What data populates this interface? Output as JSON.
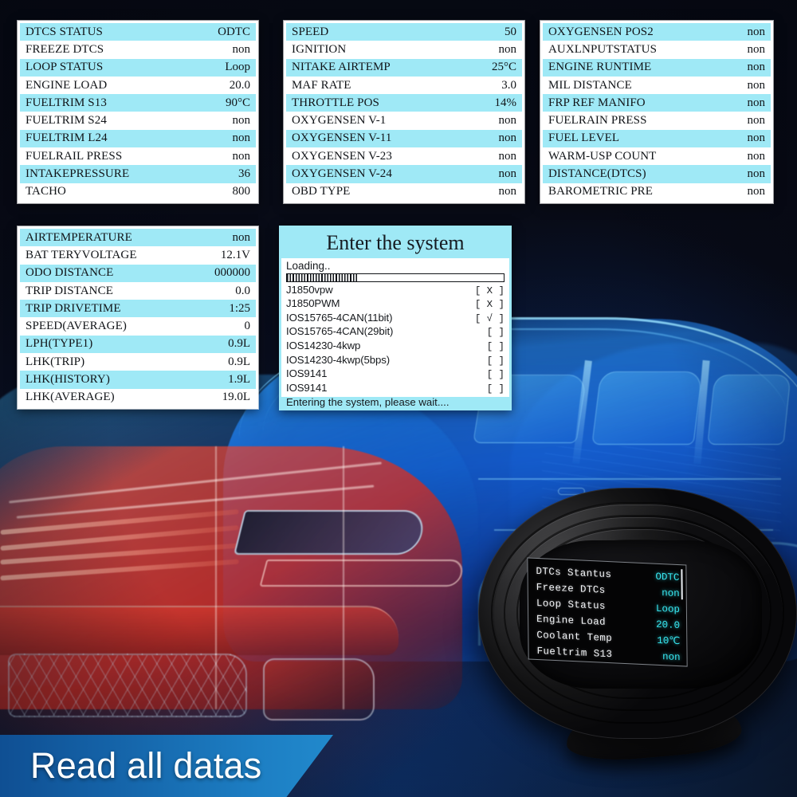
{
  "background": {
    "scene_description": "x-ray style car render",
    "colors": {
      "page_bg": "#080b16",
      "car_blue": "#1a7ae8",
      "car_red": "#cd2d24",
      "accent_cyan": "#9fe9f6"
    }
  },
  "panels": {
    "dtcs": {
      "name": "DTCS STATUS panel",
      "rows": [
        {
          "key": "DTCS STATUS",
          "value": "ODTC"
        },
        {
          "key": "FREEZE DTCS",
          "value": "non"
        },
        {
          "key": "LOOP STATUS",
          "value": "Loop"
        },
        {
          "key": "ENGINE LOAD",
          "value": "20.0"
        },
        {
          "key": "FUELTRIM S13",
          "value": "90°C"
        },
        {
          "key": "FUELTRIM S24",
          "value": "non"
        },
        {
          "key": "FUELTRIM L24",
          "value": "non"
        },
        {
          "key": "FUELRAIL PRESS",
          "value": "non"
        },
        {
          "key": "INTAKEPRESSURE",
          "value": "36"
        },
        {
          "key": "TACHO",
          "value": "800"
        }
      ]
    },
    "engine": {
      "name": "Engine data panel",
      "rows": [
        {
          "key": "SPEED",
          "value": "50"
        },
        {
          "key": "IGNITION",
          "value": "non"
        },
        {
          "key": "NITAKE AIRTEMP",
          "value": "25°C"
        },
        {
          "key": "MAF RATE",
          "value": "3.0"
        },
        {
          "key": "THROTTLE POS",
          "value": "14%"
        },
        {
          "key": "OXYGENSEN V-1",
          "value": "non"
        },
        {
          "key": "OXYGENSEN V-11",
          "value": "non"
        },
        {
          "key": "OXYGENSEN V-23",
          "value": "non"
        },
        {
          "key": "OXYGENSEN V-24",
          "value": "non"
        },
        {
          "key": "OBD TYPE",
          "value": "non"
        }
      ]
    },
    "sensors": {
      "name": "Sensor data panel",
      "rows": [
        {
          "key": "OXYGENSEN POS2",
          "value": "non"
        },
        {
          "key": "AUXLNPUTSTATUS",
          "value": "non"
        },
        {
          "key": "ENGINE RUNTIME",
          "value": "non"
        },
        {
          "key": "MIL DISTANCE",
          "value": "non"
        },
        {
          "key": "FRP REF MANIFO",
          "value": "non"
        },
        {
          "key": "FUELRAIN PRESS",
          "value": "non"
        },
        {
          "key": "FUEL LEVEL",
          "value": "non"
        },
        {
          "key": "WARM-USP COUNT",
          "value": "non"
        },
        {
          "key": "DISTANCE(DTCS)",
          "value": "non"
        },
        {
          "key": "BAROMETRIC PRE",
          "value": "non"
        }
      ]
    },
    "trip": {
      "name": "Trip data panel",
      "rows": [
        {
          "key": "AIRTEMPERATURE",
          "value": "non"
        },
        {
          "key": "BAT TERYVOLTAGE",
          "value": "12.1V"
        },
        {
          "key": "ODO DISTANCE",
          "value": "000000"
        },
        {
          "key": "TRIP DISTANCE",
          "value": "0.0"
        },
        {
          "key": "TRIP DRIVETIME",
          "value": "1:25"
        },
        {
          "key": "SPEED(AVERAGE)",
          "value": "0"
        },
        {
          "key": "LPH(TYPE1)",
          "value": "0.9L"
        },
        {
          "key": "LHK(TRIP)",
          "value": "0.9L"
        },
        {
          "key": "LHK(HISTORY)",
          "value": "1.9L"
        },
        {
          "key": "LHK(AVERAGE)",
          "value": "19.0L"
        }
      ]
    }
  },
  "enter_system": {
    "title": "Enter the system",
    "loading_label": "Loading..",
    "progress_percent": 33,
    "protocols": [
      {
        "name": "J1850vpw",
        "status": "[ X ]"
      },
      {
        "name": "J1850PWM",
        "status": "[ X ]"
      },
      {
        "name": "IOS15765-4CAN(11bit)",
        "status": "[ √ ]"
      },
      {
        "name": "IOS15765-4CAN(29bit)",
        "status": "[ ]"
      },
      {
        "name": "IOS14230-4kwp",
        "status": "[ ]"
      },
      {
        "name": "IOS14230-4kwp(5bps)",
        "status": "[ ]"
      },
      {
        "name": "IOS9141",
        "status": "[ ]"
      },
      {
        "name": "IOS9141",
        "status": "[ ]"
      }
    ],
    "footer": "Entering the system, please wait...."
  },
  "device": {
    "name": "OBD HUD display unit",
    "screen_rows": [
      {
        "key": "DTCs  Stantus",
        "value": "ODTC"
      },
      {
        "key": "Freeze DTCs",
        "value": "non"
      },
      {
        "key": "Loop  Status",
        "value": "Loop"
      },
      {
        "key": "Engine Load",
        "value": "20.0"
      },
      {
        "key": "Coolant  Temp",
        "value": "10℃"
      },
      {
        "key": "Fueltrim S13",
        "value": "non"
      }
    ]
  },
  "banner": {
    "text": "Read all datas"
  }
}
